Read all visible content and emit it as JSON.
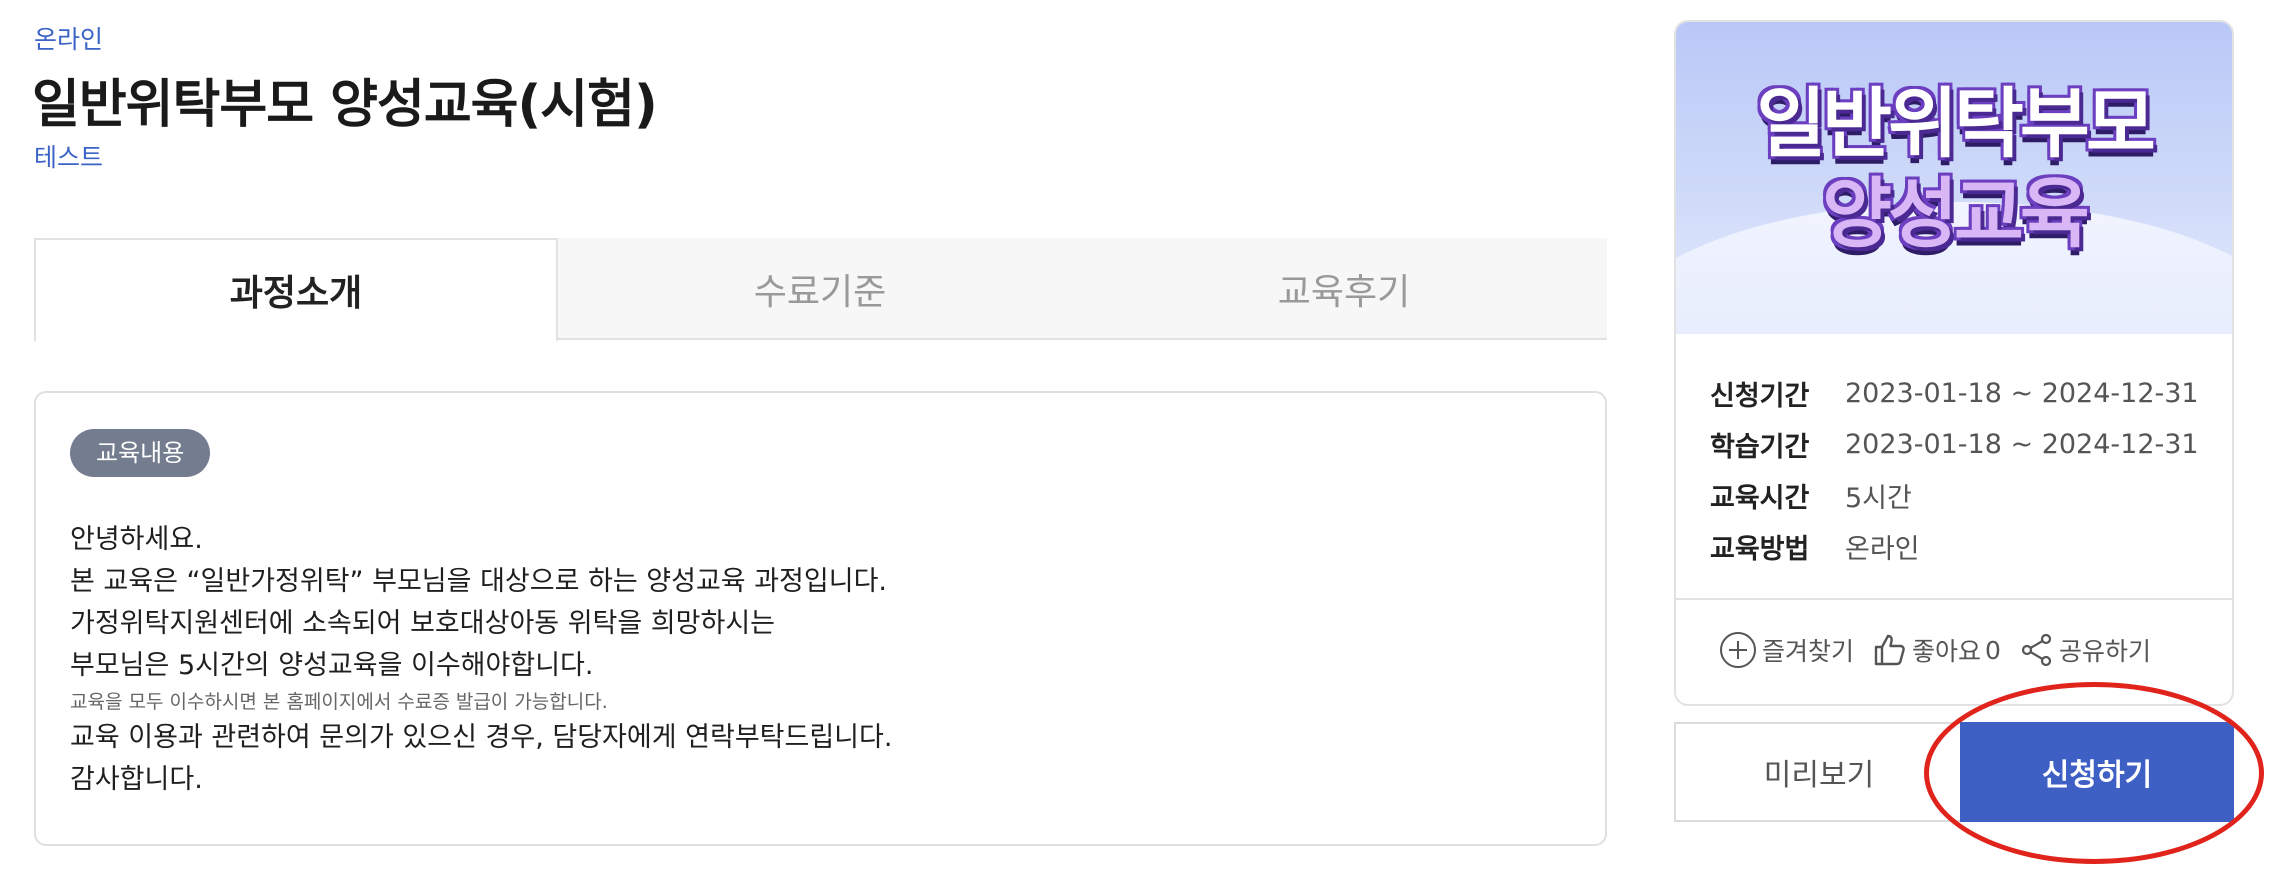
{
  "header": {
    "category": "온라인",
    "title": "일반위탁부모 양성교육(시험)",
    "subtitle": "테스트"
  },
  "tabs": [
    {
      "label": "과정소개",
      "active": true
    },
    {
      "label": "수료기준",
      "active": false
    },
    {
      "label": "교육후기",
      "active": false
    }
  ],
  "content": {
    "badge": "교육내용",
    "lines": [
      {
        "text": "안녕하세요.",
        "small": false
      },
      {
        "text": "본 교육은 “일반가정위탁” 부모님을 대상으로 하는 양성교육 과정입니다.",
        "small": false
      },
      {
        "text": "가정위탁지원센터에 소속되어 보호대상아동 위탁을 희망하시는",
        "small": false
      },
      {
        "text": "부모님은 5시간의 양성교육을 이수해야합니다.",
        "small": false
      },
      {
        "text": "교육을 모두 이수하시면 본 홈페이지에서 수료증 발급이 가능합니다.",
        "small": true
      },
      {
        "text": "교육 이용과 관련하여 문의가 있으신 경우, 담당자에게 연락부탁드립니다.",
        "small": false
      },
      {
        "text": "감사합니다.",
        "small": false
      }
    ]
  },
  "course_card": {
    "thumbnail": {
      "line1": "일반위탁부모",
      "line2": "양성교육"
    },
    "info": [
      {
        "label": "신청기간",
        "value": "2023-01-18 ~ 2024-12-31"
      },
      {
        "label": "학습기간",
        "value": "2023-01-18 ~ 2024-12-31"
      },
      {
        "label": "교육시간",
        "value": "5시간"
      },
      {
        "label": "교육방법",
        "value": "온라인"
      }
    ],
    "actions": {
      "bookmark": "즐겨찾기",
      "like": "좋아요",
      "like_count": "0",
      "share": "공유하기"
    }
  },
  "buttons": {
    "preview": "미리보기",
    "apply": "신청하기"
  },
  "colors": {
    "accent_blue": "#3e5fc4",
    "link_blue": "#3b64c6",
    "badge_gray": "#737d8f",
    "highlight_red": "#e0241b"
  }
}
